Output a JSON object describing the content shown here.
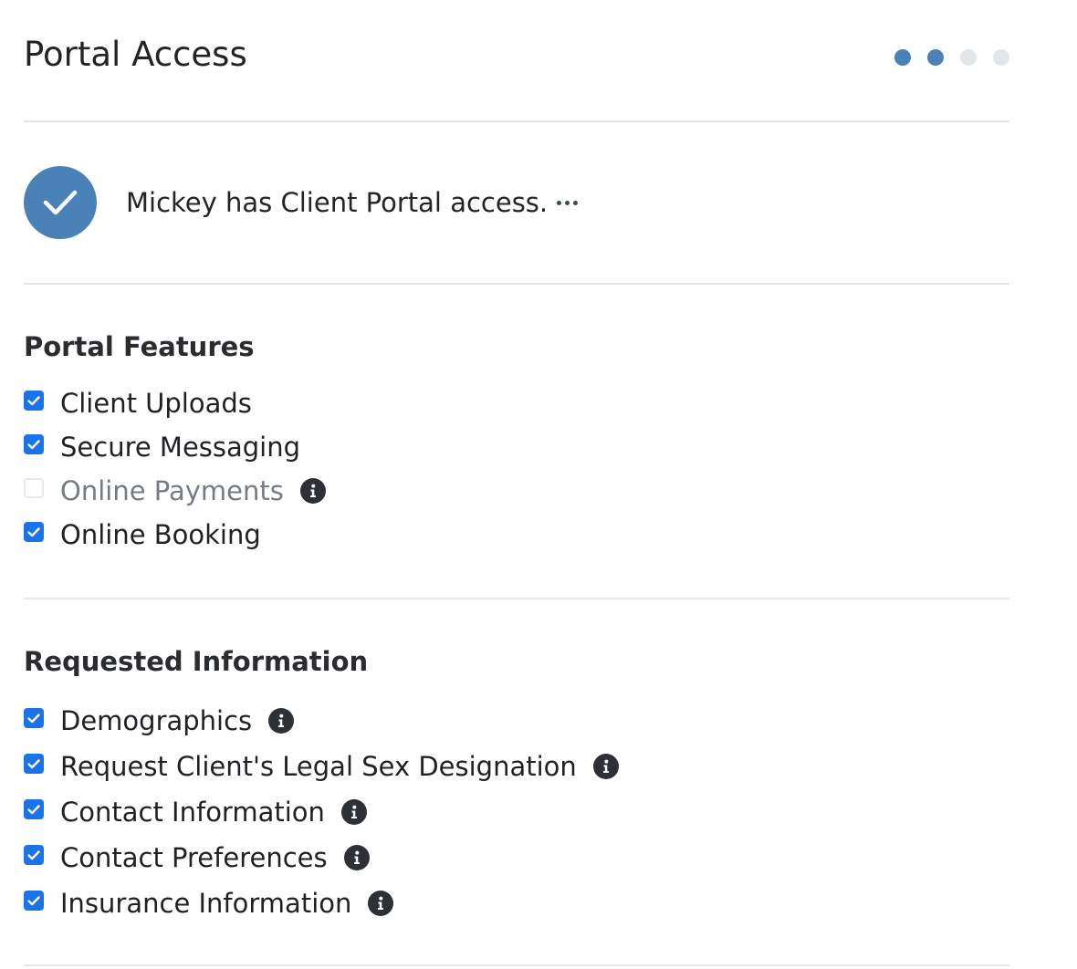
{
  "header": {
    "title": "Portal Access",
    "steps": {
      "total": 4,
      "active": 2
    }
  },
  "access": {
    "status_text": "Mickey has Client Portal access.",
    "status_icon": "check-icon",
    "more_icon": "ellipsis-icon"
  },
  "portal_features": {
    "title": "Portal Features",
    "items": [
      {
        "label": "Client Uploads",
        "checked": true,
        "disabled": false,
        "info": false
      },
      {
        "label": "Secure Messaging",
        "checked": true,
        "disabled": false,
        "info": false
      },
      {
        "label": "Online Payments",
        "checked": false,
        "disabled": true,
        "info": true
      },
      {
        "label": "Online Booking",
        "checked": true,
        "disabled": false,
        "info": false
      }
    ]
  },
  "requested_information": {
    "title": "Requested Information",
    "items": [
      {
        "label": "Demographics",
        "checked": true,
        "info": true
      },
      {
        "label": "Request Client's Legal Sex Designation",
        "checked": true,
        "info": true
      },
      {
        "label": "Contact Information",
        "checked": true,
        "info": true
      },
      {
        "label": "Contact Preferences",
        "checked": true,
        "info": true
      },
      {
        "label": "Insurance Information",
        "checked": true,
        "info": true
      }
    ]
  },
  "colors": {
    "accent": "#4a82b8",
    "checkbox": "#1a73e8",
    "divider": "#e3e5e8",
    "info_icon": "#2d3035"
  }
}
